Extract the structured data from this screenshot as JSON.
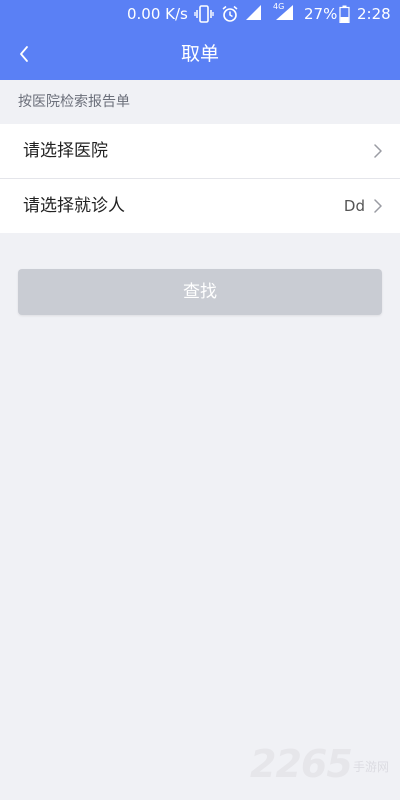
{
  "status_bar": {
    "net_speed": "0.00 K/s",
    "network_type": "4G",
    "battery_percent": "27%",
    "time": "2:28"
  },
  "nav": {
    "title": "取单",
    "back_icon": "chevron-left-icon"
  },
  "section": {
    "label": "按医院检索报告单"
  },
  "list": {
    "items": [
      {
        "label": "请选择医院",
        "value": ""
      },
      {
        "label": "请选择就诊人",
        "value": "Dd"
      }
    ]
  },
  "actions": {
    "search_label": "查找"
  },
  "watermark": {
    "number": "2265",
    "text": "手游网"
  },
  "colors": {
    "header": "#5a80f5",
    "background": "#f0f1f5",
    "button_disabled": "#c9ccd3"
  }
}
